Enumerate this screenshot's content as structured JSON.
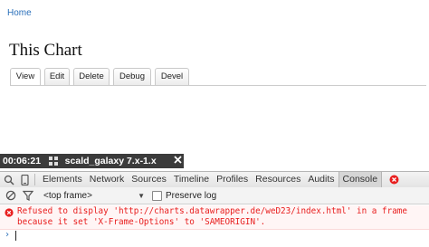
{
  "page": {
    "home_link": "Home",
    "title": "This Chart",
    "tabs": [
      {
        "label": "View",
        "active": true
      },
      {
        "label": "Edit",
        "active": false
      },
      {
        "label": "Delete",
        "active": false
      },
      {
        "label": "Debug",
        "active": false
      },
      {
        "label": "Devel",
        "active": false
      }
    ]
  },
  "status_bar": {
    "time": "00:06:21",
    "icon": "grid-icon",
    "branch": "scald_galaxy 7.x-1.x",
    "close_icon": "close-icon"
  },
  "devtools": {
    "tabs": [
      "Elements",
      "Network",
      "Sources",
      "Timeline",
      "Profiles",
      "Resources",
      "Audits",
      "Console"
    ],
    "selected_tab": "Console",
    "error_count_icon": "error-icon",
    "filter": {
      "frame": "<top frame>",
      "preserve_log": "Preserve log",
      "preserve_log_checked": false
    },
    "console": {
      "message_line1": "Refused to display 'http://charts.datawrapper.de/weD23/index.html' in a frame",
      "message_line2": "because it set 'X-Frame-Options' to 'SAMEORIGIN'.",
      "prompt": "›"
    },
    "colors": {
      "error": "#e81e1e",
      "link": "#2a6fba"
    }
  }
}
